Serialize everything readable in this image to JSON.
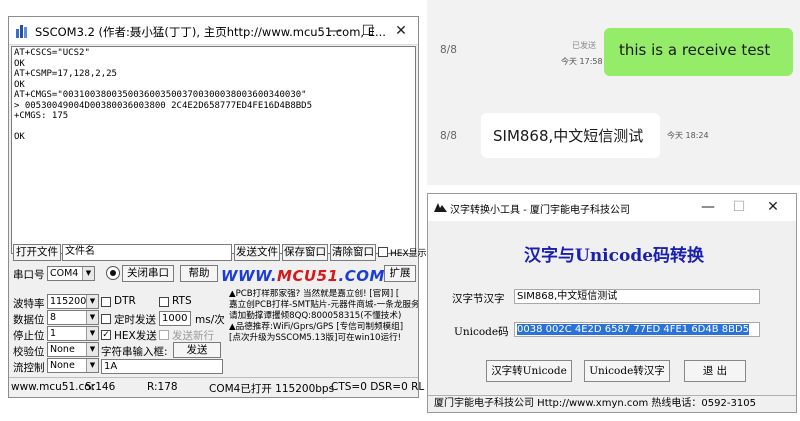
{
  "sscom": {
    "title": "SSCOM3.2 (作者:聂小猛(丁丁), 主页http://www.mcu51.com, E...",
    "controls": {
      "minimize": "—",
      "maximize": "☐",
      "close": "✕"
    },
    "terminal_lines": [
      "AT+CSCS=\"UCS2\"",
      "OK",
      "AT+CSMP=17,128,2,25",
      "OK",
      "AT+CMGS=\"00310038003500360035003700300038003600340030\"",
      "> 00530049004D00380036003800 2C4E2D658777ED4FE16D4B8BD5",
      "+CMGS: 175",
      "",
      "OK"
    ],
    "row1": {
      "open_file": "打开文件",
      "file_name": "文件名",
      "send_file": "发送文件",
      "save_window": "保存窗口",
      "clear_window": "清除窗口",
      "hex_display": "HEX显示"
    },
    "row2": {
      "port_label": "串口号",
      "port_value": "COM4",
      "close_port": "关闭串口",
      "help": "帮助",
      "expand": "扩展"
    },
    "logo_main": "WWW.",
    "logo_hi": "MCU51",
    "logo_end": ".COM",
    "settings": {
      "baud_label": "波特率",
      "baud_value": "115200",
      "data_label": "数据位",
      "data_value": "8",
      "stop_label": "停止位",
      "stop_value": "1",
      "parity_label": "校验位",
      "parity_value": "None",
      "flow_label": "流控制",
      "flow_value": "None"
    },
    "options": {
      "dtr": "DTR",
      "rts": "RTS",
      "timed_send": "定时发送",
      "interval": "1000",
      "interval_unit": "ms/次",
      "hex_send": "HEX发送",
      "send_newline": "发送新行",
      "string_input": "字符串输入框:",
      "send": "发送",
      "input_value": "1A"
    },
    "ad_lines": [
      "▲PCB打样那家强? 当然就是嘉立创! [官网] [",
      "嘉立创PCB打样-SMT贴片-元器件商城-一条龙服务",
      "请加勤撑谭攫倾8QQ:800058315(不懂技术)",
      "▲品德推荐:WiFi/Gprs/GPS [专信司制频模组]",
      "[点次升级为SSCOM5.13版]可在win10运行!"
    ],
    "status": {
      "site": "www.mcu51.cor",
      "sent": "S:146",
      "recv": "R:178",
      "port_status": "COM4已打开  115200bps",
      "signals": "CTS=0 DSR=0 RL"
    }
  },
  "chat": {
    "date1": "8/8",
    "sent_name": "已发送",
    "sent_text": "this is a receive test",
    "sent_time": "今天 17:58",
    "date2": "8/8",
    "recv_text": "SIM868,中文短信测试",
    "recv_time": "今天 18:24"
  },
  "converter": {
    "title": "汉字转换小工具 - 厦门宇能电子科技公司",
    "heading": "汉字与Unicode码转换",
    "hanzi_label": "汉字节汉字",
    "hanzi_value": "SIM868,中文短信测试",
    "unicode_label": "Unicode码",
    "unicode_value": "0038 002C 4E2D 6587 77ED 4FE1 6D4B 8BD5",
    "to_unicode": "汉字转Unicode",
    "to_hanzi": "Unicode转汉字",
    "exit": "退 出",
    "status": "厦门宇能电子科技公司  Http://www.xmyn.com  热线电话：0592-3105"
  },
  "colors": {
    "sent_bubble": "#95ec69",
    "heading_blue": "#1a20b0",
    "logo_blue": "#1a3cd8",
    "logo_red": "#d41a1a",
    "selection": "#2a72d8"
  }
}
